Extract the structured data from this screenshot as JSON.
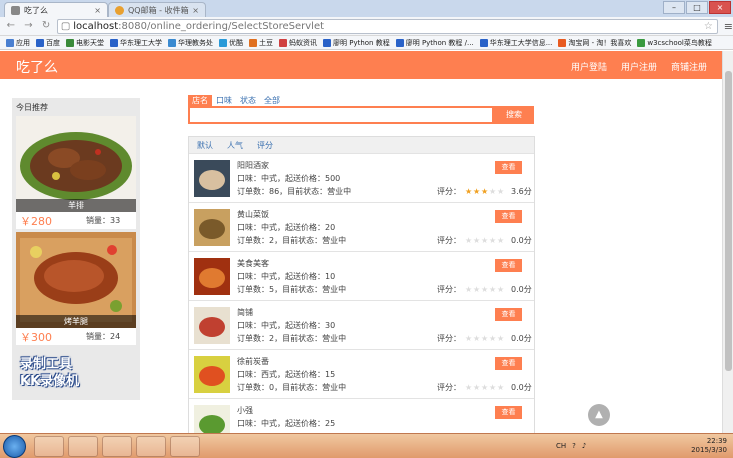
{
  "browser": {
    "tabs": [
      {
        "title": "吃了么",
        "active": true
      },
      {
        "title": "QQ邮箱 - 收件箱",
        "active": false
      }
    ],
    "address": {
      "host": "localhost",
      "path": ":8080/online_ordering/SelectStoreServlet"
    },
    "bookmarks": [
      "应用",
      "百度",
      "电影天堂",
      "华东理工大学",
      "华理教务处",
      "优酷",
      "土豆",
      "蚂蚁资讯",
      "廖明 Python 教程",
      "廖明 Python 教程 /...",
      "华东理工大学信息...",
      "淘宝网 - 淘！我喜欢",
      "w3cschool菜鸟教程"
    ]
  },
  "header": {
    "logo": "吃了么",
    "nav": [
      "用户登陆",
      "用户注册",
      "商铺注册"
    ]
  },
  "sidebar": {
    "title": "今日推荐",
    "dishes": [
      {
        "name": "羊排",
        "price": "￥280",
        "sales": "销量：33"
      },
      {
        "name": "烤羊腿",
        "price": "￥300",
        "sales": "销量：24"
      }
    ]
  },
  "search": {
    "tabs": [
      "店名",
      "口味",
      "状态",
      "全部"
    ],
    "active_tab": "店名",
    "button": "搜索",
    "value": ""
  },
  "sort_tabs": [
    "默认",
    "人气",
    "评分"
  ],
  "stores": [
    {
      "name": "阳阳酒家",
      "line2": "口味：中式，起送价格：500",
      "line3": "订单数：86，目前状态：营业中",
      "rating_label": "评分：",
      "stars": 3,
      "score": "3.6分",
      "button": "查看"
    },
    {
      "name": "黄山菜饭",
      "line2": "口味：中式，起送价格：20",
      "line3": "订单数：2，目前状态：营业中",
      "rating_label": "评分：",
      "stars": 0,
      "score": "0.0分",
      "button": "查看"
    },
    {
      "name": "美食美客",
      "line2": "口味：中式，起送价格：10",
      "line3": "订单数：5，目前状态：营业中",
      "rating_label": "评分：",
      "stars": 0,
      "score": "0.0分",
      "button": "查看"
    },
    {
      "name": "简铺",
      "line2": "口味：中式，起送价格：30",
      "line3": "订单数：2，目前状态：营业中",
      "rating_label": "评分：",
      "stars": 0,
      "score": "0.0分",
      "button": "查看"
    },
    {
      "name": "徐前炭番",
      "line2": "口味：西式，起送价格：15",
      "line3": "订单数：0，目前状态：营业中",
      "rating_label": "评分：",
      "stars": 0,
      "score": "0.0分",
      "button": "查看"
    },
    {
      "name": "小强",
      "line2": "口味：中式，起送价格：25",
      "line3": "",
      "rating_label": "",
      "stars": 0,
      "score": "",
      "button": "查看"
    }
  ],
  "watermark": [
    "录制工具",
    "KK录像机"
  ],
  "taskbar": {
    "lang": "CH",
    "time": "22:39",
    "date": "2015/3/30"
  },
  "colors": {
    "accent": "#fe7f50",
    "star": "#f0a020",
    "link": "#3a70b0"
  }
}
